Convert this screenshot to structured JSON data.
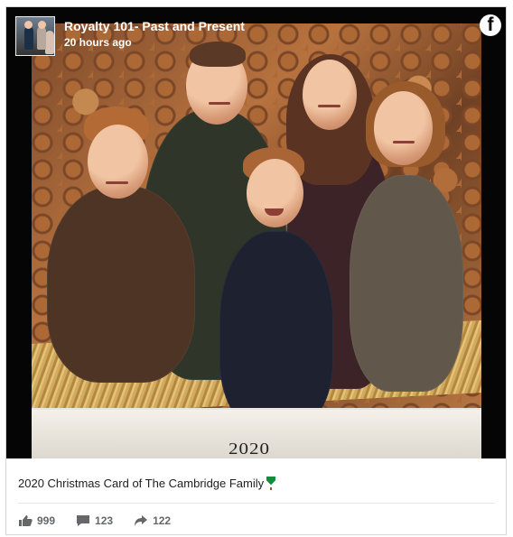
{
  "post": {
    "page_name": "Royalty 101- Past and Present",
    "time": "20 hours ago",
    "caption": "2020 Christmas Card of The Cambridge Family",
    "caption_emoji": "🎄",
    "network_icon": "facebook-logo-icon"
  },
  "photo": {
    "year_text": "2020"
  },
  "stats": {
    "likes": "999",
    "comments": "123",
    "shares": "122",
    "like_icon": "thumbs-up-icon",
    "comment_icon": "comment-bubble-icon",
    "share_icon": "share-arrow-icon"
  },
  "colors": {
    "background": "#ffffff",
    "media_black": "#050505",
    "meta_text": "#65676b",
    "caption_text": "#1c1e21"
  }
}
